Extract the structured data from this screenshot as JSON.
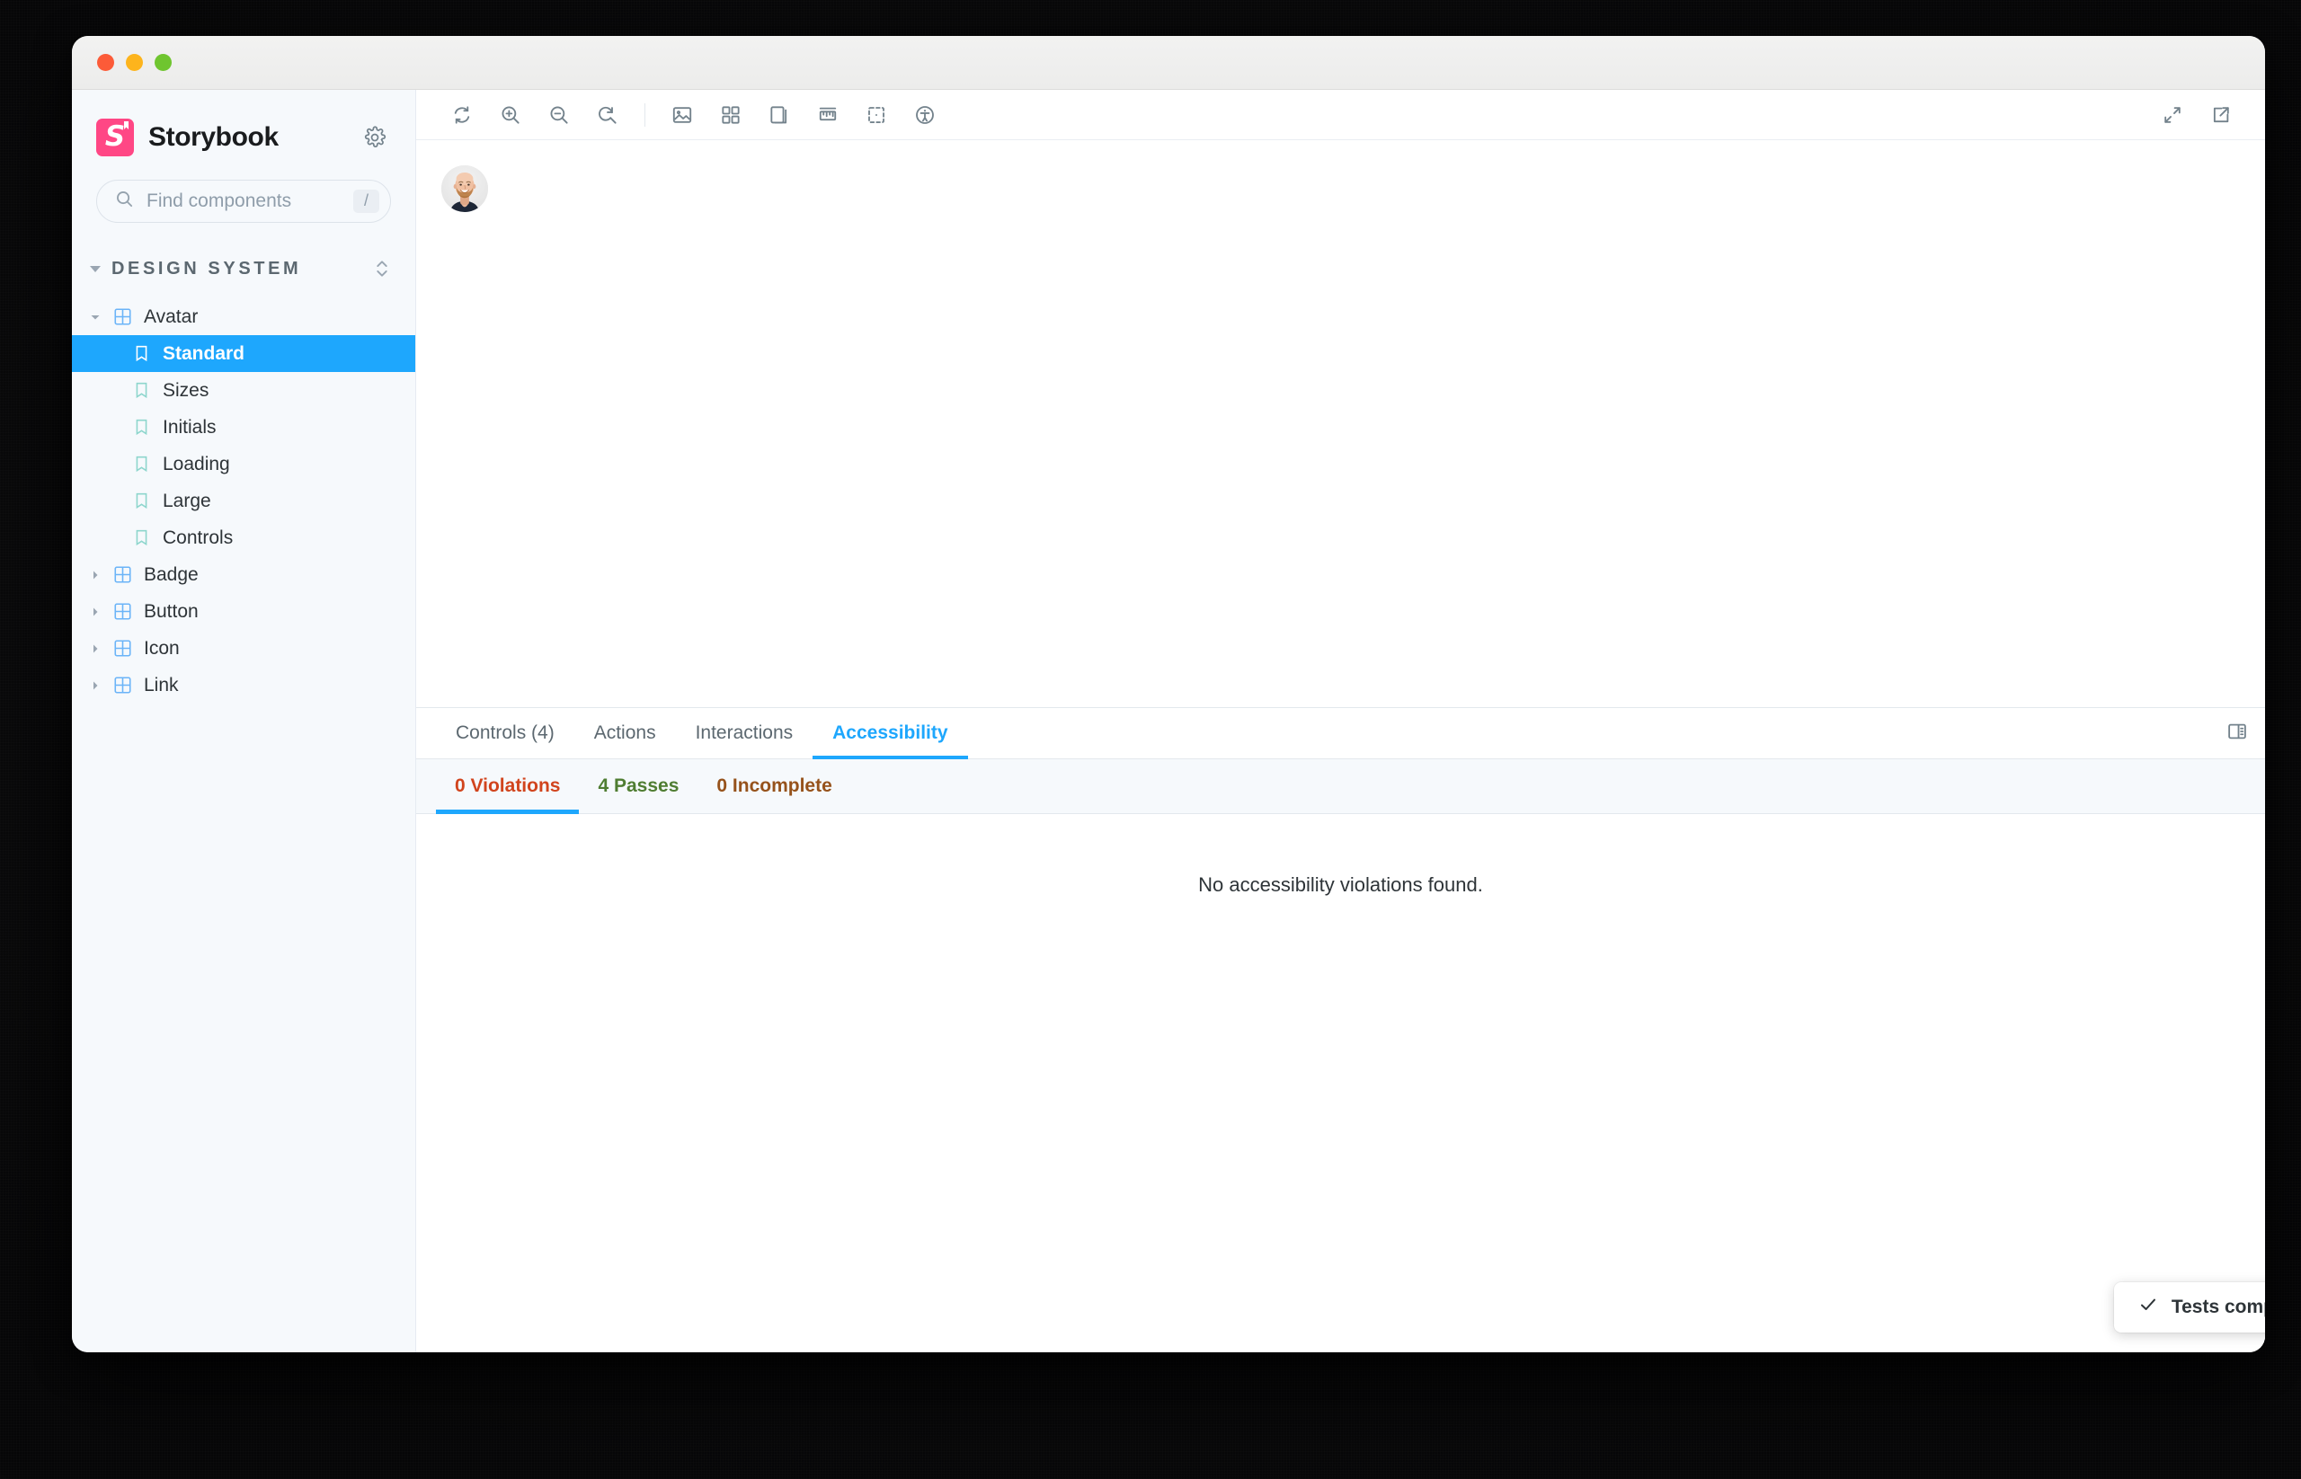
{
  "window": {
    "traffic_lights": [
      "close",
      "minimize",
      "zoom"
    ]
  },
  "sidebar": {
    "brand": "Storybook",
    "logo_color": "#ff4785",
    "settings_icon": "gear-icon",
    "search": {
      "placeholder": "Find components",
      "value": "",
      "shortcut": "/",
      "icon": "search-icon"
    },
    "section": {
      "title": "DESIGN SYSTEM",
      "expanded": true,
      "selector_icon": "chevron-up-down-icon"
    },
    "tree": [
      {
        "label": "Avatar",
        "type": "component",
        "expanded": true,
        "selected": false,
        "icon": "component-grid-icon"
      },
      {
        "label": "Standard",
        "type": "story",
        "expanded": false,
        "selected": true,
        "icon": "story-bookmark-icon"
      },
      {
        "label": "Sizes",
        "type": "story",
        "expanded": false,
        "selected": false,
        "icon": "story-bookmark-icon"
      },
      {
        "label": "Initials",
        "type": "story",
        "expanded": false,
        "selected": false,
        "icon": "story-bookmark-icon"
      },
      {
        "label": "Loading",
        "type": "story",
        "expanded": false,
        "selected": false,
        "icon": "story-bookmark-icon"
      },
      {
        "label": "Large",
        "type": "story",
        "expanded": false,
        "selected": false,
        "icon": "story-bookmark-icon"
      },
      {
        "label": "Controls",
        "type": "story",
        "expanded": false,
        "selected": false,
        "icon": "story-bookmark-icon"
      },
      {
        "label": "Badge",
        "type": "component",
        "expanded": false,
        "selected": false,
        "icon": "component-grid-icon"
      },
      {
        "label": "Button",
        "type": "component",
        "expanded": false,
        "selected": false,
        "icon": "component-grid-icon"
      },
      {
        "label": "Icon",
        "type": "component",
        "expanded": false,
        "selected": false,
        "icon": "component-grid-icon"
      },
      {
        "label": "Link",
        "type": "component",
        "expanded": false,
        "selected": false,
        "icon": "component-grid-icon"
      }
    ],
    "selected_color": "#1ea7fd"
  },
  "toolbar": {
    "left_buttons": [
      {
        "name": "remount-button",
        "icon": "refresh-icon",
        "title": "Remount component"
      },
      {
        "name": "zoom-in-button",
        "icon": "zoom-in-icon",
        "title": "Zoom in"
      },
      {
        "name": "zoom-out-button",
        "icon": "zoom-out-icon",
        "title": "Zoom out"
      },
      {
        "name": "zoom-reset-button",
        "icon": "zoom-reset-icon",
        "title": "Reset zoom"
      }
    ],
    "addon_buttons": [
      {
        "name": "backgrounds-button",
        "icon": "image-icon",
        "title": "Change background"
      },
      {
        "name": "grid-button",
        "icon": "grid-icon",
        "title": "Apply grid"
      },
      {
        "name": "viewport-button",
        "icon": "stacked-layers-icon",
        "title": "Change viewport"
      },
      {
        "name": "measure-button",
        "icon": "ruler-icon",
        "title": "Measure"
      },
      {
        "name": "outline-button",
        "icon": "outline-icon",
        "title": "Outline"
      },
      {
        "name": "accessibility-button",
        "icon": "accessibility-icon",
        "title": "Accessibility"
      }
    ],
    "right_buttons": [
      {
        "name": "fullscreen-button",
        "icon": "expand-arrows-icon",
        "title": "Go full screen"
      },
      {
        "name": "open-new-tab-button",
        "icon": "external-link-icon",
        "title": "Open canvas in new tab"
      }
    ]
  },
  "canvas": {
    "story": "Avatar / Standard",
    "avatar_alt": "Avatar photo"
  },
  "panel": {
    "tabs": [
      {
        "label": "Controls (4)",
        "active": false
      },
      {
        "label": "Actions",
        "active": false
      },
      {
        "label": "Interactions",
        "active": false
      },
      {
        "label": "Accessibility",
        "active": true
      }
    ],
    "layout_icon": "panel-position-icon",
    "subtabs": [
      {
        "label": "0 Violations",
        "active": true,
        "kind": "violations",
        "color": "#d1441d"
      },
      {
        "label": "4 Passes",
        "active": false,
        "kind": "passes",
        "color": "#4f7d32"
      },
      {
        "label": "0 Incomplete",
        "active": false,
        "kind": "incomplete",
        "color": "#96521b"
      }
    ],
    "empty_message": "No accessibility violations found.",
    "active_color": "#1ea7fd"
  },
  "toast": {
    "message": "Tests completed",
    "icon": "check-icon"
  }
}
